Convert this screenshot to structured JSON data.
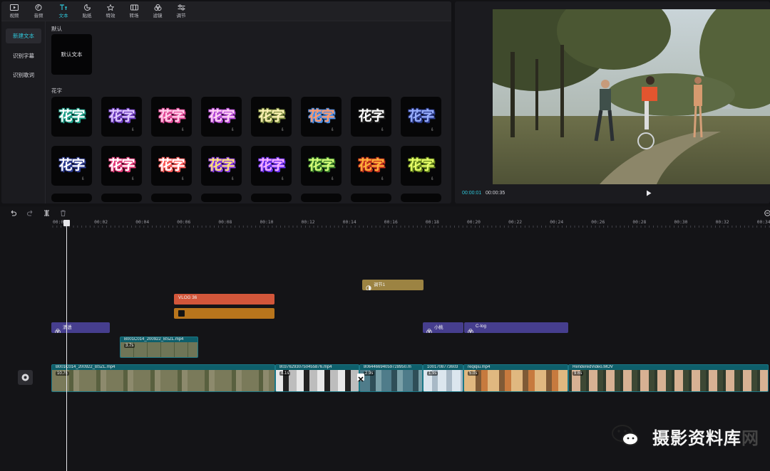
{
  "toolbar": {
    "tabs": [
      {
        "label": "视频",
        "icon": "video-icon"
      },
      {
        "label": "音频",
        "icon": "audio-icon"
      },
      {
        "label": "文本",
        "icon": "text-icon"
      },
      {
        "label": "贴纸",
        "icon": "sticker-icon"
      },
      {
        "label": "特效",
        "icon": "effects-icon"
      },
      {
        "label": "转场",
        "icon": "transition-icon"
      },
      {
        "label": "滤镜",
        "icon": "filter-icon"
      },
      {
        "label": "调节",
        "icon": "adjust-icon"
      }
    ],
    "active_tab": "文本"
  },
  "sidebar": {
    "items": [
      {
        "label": "新建文本",
        "active": true
      },
      {
        "label": "识别字幕",
        "active": false
      },
      {
        "label": "识别歌词",
        "active": false
      }
    ]
  },
  "content": {
    "default_section": "默认",
    "default_card": "默认文本",
    "fancy_section": "花字",
    "fancy_word": "花字",
    "download_glyph": "⇩"
  },
  "preview": {
    "current_time": "00:00:01",
    "total_time": "00:00:35"
  },
  "timeline": {
    "ruler": [
      "00:00",
      "00:02",
      "00:04",
      "00:06",
      "00:08",
      "00:10",
      "00:12",
      "00:14",
      "00:16",
      "00:18",
      "00:20",
      "00:22",
      "00:24",
      "00:26",
      "00:28",
      "00:30",
      "00:32",
      "00:34"
    ],
    "clips": {
      "adjust_label": "调节1",
      "vlog_label": "VLOG 36",
      "filter_a_label": "清透",
      "filter_b_label": "小桃",
      "filter_c_label": "C-log",
      "overlay_name": "B001C014_200922_BSZL.mp4",
      "overlay_speed": "3.7s"
    },
    "main_track": [
      {
        "name": "B001C014_200922_BSZL.mp4",
        "speed": "10.7s"
      },
      {
        "name": "803762930750455876.mp4",
        "speed": "4.1s"
      },
      {
        "name": "806446694059728950.m",
        "speed": "2.9s"
      },
      {
        "name": "1001708773603",
        "speed": "1.9s"
      },
      {
        "name": "reqiqiu.mp4",
        "speed": "5.0s"
      },
      {
        "name": "RenderedVideo.MOV",
        "speed": "9.6s"
      }
    ]
  },
  "watermark": {
    "text": "摄影资料库",
    "suffix": "网"
  },
  "colors": {
    "accent": "#2ec5d8",
    "video_track": "#0e5f6b",
    "filter_clip": "#463e8e",
    "text_clip": "#d2563a",
    "sticker_clip": "#b8751c",
    "adjust_clip": "#9c8342"
  }
}
